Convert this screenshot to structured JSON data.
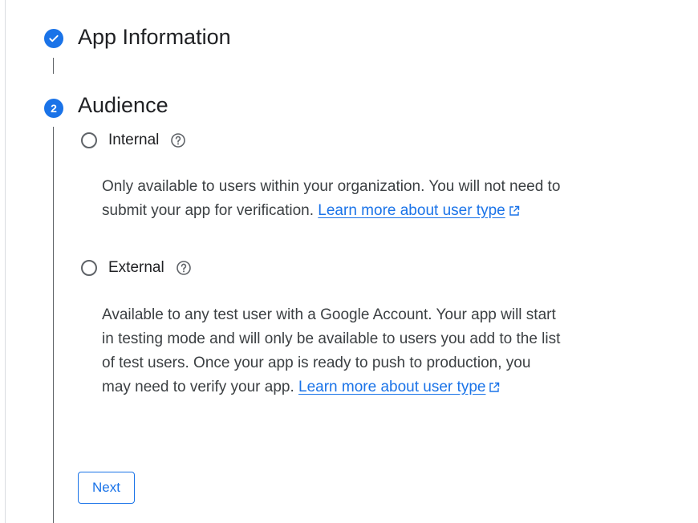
{
  "steps": [
    {
      "title": "App Information",
      "status": "completed",
      "icon": "check-icon"
    },
    {
      "title": "Audience",
      "number": "2",
      "status": "active"
    }
  ],
  "audience": {
    "options": [
      {
        "label": "Internal",
        "selected": false,
        "help_icon": "help-icon",
        "description": "Only available to users within your organization. You will not need to submit your app for verification.",
        "link_text": "Learn more about user type",
        "link_icon": "external-link-icon"
      },
      {
        "label": "External",
        "selected": false,
        "help_icon": "help-icon",
        "description": "Available to any test user with a Google Account. Your app will start in testing mode and will only be available to users you add to the list of test users. Once your app is ready to push to production, you may need to verify your app.",
        "link_text": "Learn more about user type",
        "link_icon": "external-link-icon"
      }
    ]
  },
  "actions": {
    "next_label": "Next"
  },
  "colors": {
    "accent": "#1a73e8",
    "text": "#202124",
    "secondary_text": "#3c4043",
    "line": "#5f6368"
  }
}
